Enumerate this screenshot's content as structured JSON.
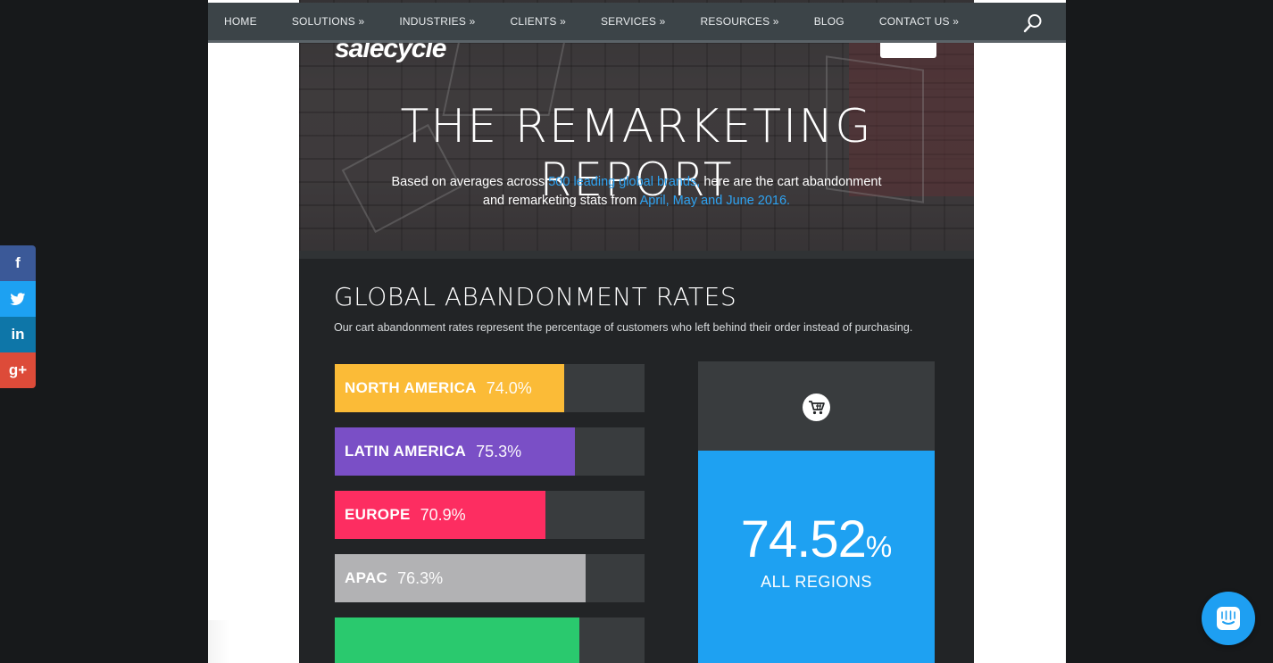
{
  "nav": {
    "items": [
      {
        "label": "HOME"
      },
      {
        "label": "SOLUTIONS »"
      },
      {
        "label": "INDUSTRIES »"
      },
      {
        "label": "CLIENTS »"
      },
      {
        "label": "SERVICES »"
      },
      {
        "label": "RESOURCES »"
      },
      {
        "label": "BLOG"
      },
      {
        "label": "CONTACT US »"
      }
    ],
    "search_icon": "search-icon"
  },
  "hero": {
    "logo": "salecycle",
    "title": "THE REMARKETING REPORT",
    "sub_1": "Based on averages across ",
    "sub_hl1": "500 leading global brands,",
    "sub_2": " here are the cart abandonment and remarketing stats from ",
    "sub_hl2": "April, May and June 2016."
  },
  "section": {
    "title": "GLOBAL ABANDONMENT RATES",
    "description": "Our cart abandonment rates represent the percentage of customers who left behind their order instead of purchasing."
  },
  "regions": [
    {
      "name": "NORTH AMERICA",
      "value_label": "74.0%",
      "fill": 0.74,
      "color": "#fbbb37"
    },
    {
      "name": "LATIN AMERICA",
      "value_label": "75.3%",
      "fill": 0.775,
      "color": "#7a4fc6"
    },
    {
      "name": "EUROPE",
      "value_label": "70.9%",
      "fill": 0.68,
      "color": "#fd2d61"
    },
    {
      "name": "APAC",
      "value_label": "76.3%",
      "fill": 0.81,
      "color": "#b2b2b4"
    },
    {
      "name": "",
      "value_label": "",
      "fill": 0.79,
      "color": "#2ac96e"
    }
  ],
  "summary": {
    "icon": "cart-icon",
    "value": "74.52",
    "unit": "%",
    "label": "ALL REGIONS"
  },
  "social": [
    {
      "label": "f",
      "icon": "facebook-icon"
    },
    {
      "label": "t",
      "icon": "twitter-icon"
    },
    {
      "label": "in",
      "icon": "linkedin-icon"
    },
    {
      "label": "g+",
      "icon": "google-plus-icon"
    }
  ],
  "colors": {
    "accent": "#2ea3f2",
    "panel_blue": "#1ea1f2",
    "nav_bg": "#3c4448"
  }
}
